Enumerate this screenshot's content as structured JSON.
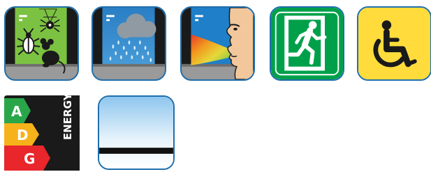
{
  "icons": [
    {
      "name": "pests-icon"
    },
    {
      "name": "rain-icon"
    },
    {
      "name": "air-quality-icon"
    },
    {
      "name": "emergency-exit-icon"
    },
    {
      "name": "wheelchair-icon"
    },
    {
      "name": "energy-rating-icon",
      "classes": [
        "A",
        "D",
        "G"
      ],
      "word": "ENERGY"
    },
    {
      "name": "window-icon"
    }
  ],
  "colors": {
    "tile_border": "#1f6fad",
    "pest_green": "#7cc242",
    "sky_blue": "#1f7fc8",
    "exit_green": "#00a04a",
    "wheelchair_yellow": "#ffdc3c",
    "energy_a": "#2aa64a",
    "energy_d": "#f6b21a",
    "energy_g": "#e8262b"
  }
}
